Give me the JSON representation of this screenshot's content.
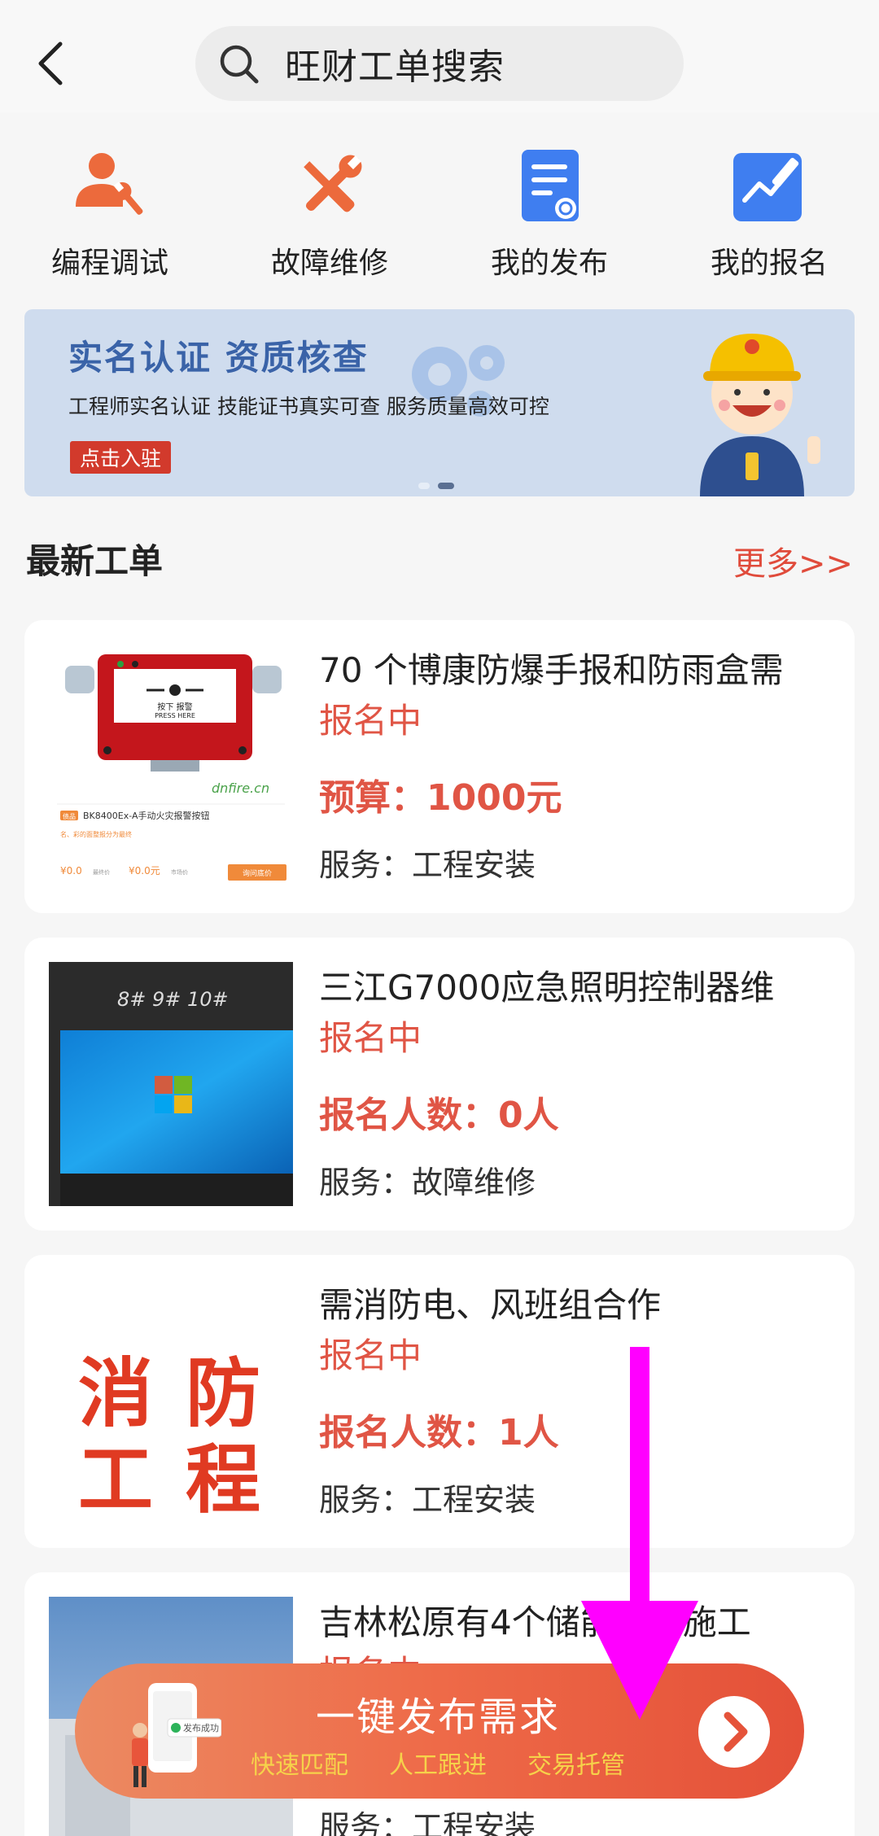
{
  "search": {
    "placeholder": "旺财工单搜索"
  },
  "quick_actions": [
    {
      "label": "编程调试",
      "icon": "engineer-wrench-icon"
    },
    {
      "label": "故障维修",
      "icon": "crossed-tools-icon"
    },
    {
      "label": "我的发布",
      "icon": "document-publish-icon"
    },
    {
      "label": "我的报名",
      "icon": "edit-signup-icon"
    }
  ],
  "banner": {
    "title": "实名认证  资质核查",
    "subtitle": "工程师实名认证    技能证书真实可查   服务质量高效可控",
    "button": "点击入驻"
  },
  "section": {
    "title": "最新工单",
    "more": "更多>>"
  },
  "orders": [
    {
      "title": "70 个博康防爆手报和防雨盒需",
      "status": "报名中",
      "highlight": "预算：1000元",
      "service": "服务：工程安装",
      "thumb": {
        "panel_top": "按下 报警",
        "panel_bottom": "PRESS HERE",
        "brand": "dnfire.cn",
        "tag": "债品",
        "product": "BK8400Ex-A手动火灾报警按钮",
        "desc": "名、彩的面整报分为最终",
        "price1": "¥0.0",
        "price1_label": "最终价",
        "price2": "¥0.0元",
        "price2_label": "市场价",
        "button": "询问底价"
      }
    },
    {
      "title": "三江G7000应急照明控制器维",
      "status": "报名中",
      "highlight": "报名人数：0人",
      "service": "服务：故障维修",
      "thumb": {
        "marks": "8#  9#  10#"
      }
    },
    {
      "title": "需消防电、风班组合作",
      "status": "报名中",
      "highlight": "报名人数：1人",
      "service": "服务：工程安装",
      "thumb": {
        "line1": "消 防",
        "line2": "工 程"
      }
    },
    {
      "title": "吉林松原有4个储能全需施工",
      "status": "报名中",
      "highlight": "",
      "service": "服务：工程安装"
    }
  ],
  "fab": {
    "title": "一键发布需求",
    "tags": [
      "快速匹配",
      "人工跟进",
      "交易托管"
    ],
    "badge": "发布成功"
  },
  "colors": {
    "accent_red": "#e05545",
    "banner_blue": "#3a63a8",
    "fab_orange": "#ee6a48",
    "overlay_arrow": "#ff00ff"
  }
}
